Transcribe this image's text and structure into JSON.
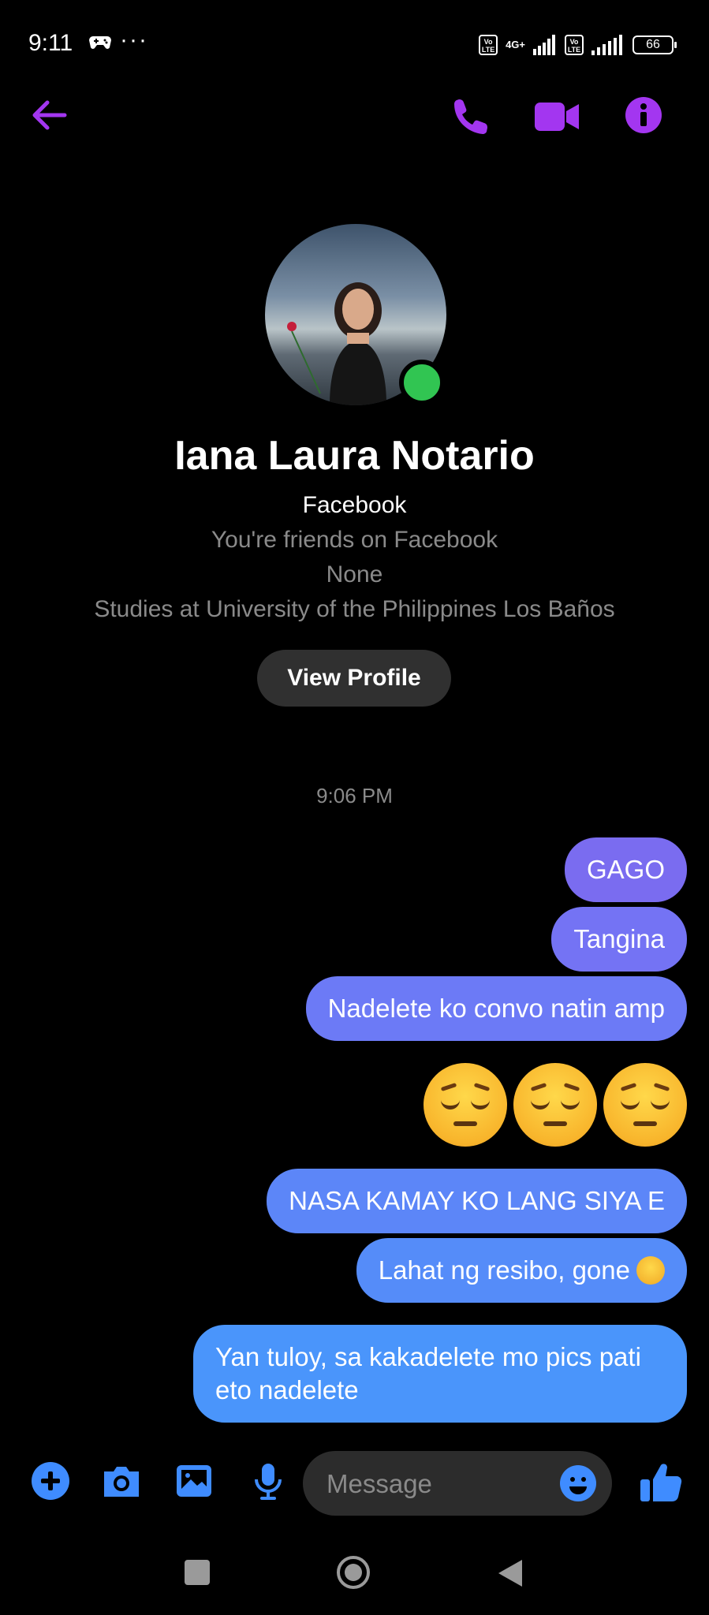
{
  "status_bar": {
    "time": "9:11",
    "dots": "···",
    "volte_label": "Vo LTE",
    "network": "4G+",
    "battery": "66"
  },
  "colors": {
    "accent_purple": "#a336f0",
    "bubble_top": "#7a6cf0",
    "bubble_bottom": "#4a95fb",
    "composer_blue": "#3f8cff",
    "online_green": "#31c552"
  },
  "header": {
    "icons": [
      "back-arrow-icon",
      "phone-icon",
      "video-icon",
      "info-icon"
    ]
  },
  "profile": {
    "name": "Iana Laura Notario",
    "platform": "Facebook",
    "friend_status": "You're friends on Facebook",
    "line2": "None",
    "education": "Studies at University of the Philippines Los Baños",
    "view_profile_label": "View Profile"
  },
  "chat": {
    "timestamp": "9:06 PM",
    "messages": [
      "GAGO",
      "Tangina",
      "Nadelete ko convo natin amp",
      "😔😔😔",
      "NASA KAMAY KO LANG SIYA E",
      "Lahat ng resibo, gone",
      "Yan tuloy, sa kakadelete mo pics pati eto nadelete"
    ]
  },
  "composer": {
    "placeholder": "Message",
    "icons": [
      "plus-icon",
      "camera-icon",
      "gallery-icon",
      "microphone-icon",
      "emoji-icon",
      "thumbs-up-icon"
    ]
  },
  "nav": {
    "icons": [
      "recents-icon",
      "home-icon",
      "back-icon"
    ]
  }
}
